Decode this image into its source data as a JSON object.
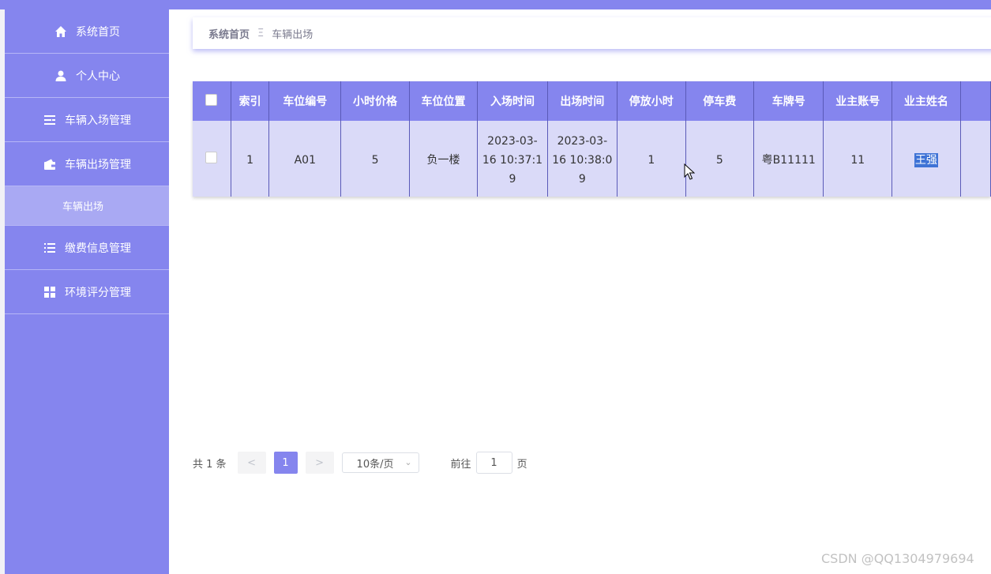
{
  "sidebar": {
    "items": [
      {
        "label": "系统首页",
        "icon": "home-icon"
      },
      {
        "label": "个人中心",
        "icon": "user-icon"
      },
      {
        "label": "车辆入场管理",
        "icon": "list-icon"
      },
      {
        "label": "车辆出场管理",
        "icon": "wallet-icon"
      },
      {
        "label": "车辆出场",
        "icon": ""
      },
      {
        "label": "缴费信息管理",
        "icon": "list-icon"
      },
      {
        "label": "环境评分管理",
        "icon": "grid-icon"
      }
    ]
  },
  "breadcrumb": {
    "home": "系统首页",
    "separator": "Ξ",
    "current": "车辆出场"
  },
  "table": {
    "headers": [
      "索引",
      "车位编号",
      "小时价格",
      "车位位置",
      "入场时间",
      "出场时间",
      "停放小时",
      "停车费",
      "车牌号",
      "业主账号",
      "业主姓名"
    ],
    "rows": [
      {
        "index": "1",
        "spot": "A01",
        "price": "5",
        "location": "负一楼",
        "in_time_1": "2023-03-",
        "in_time_2": "16 10:37:1",
        "in_time_3": "9",
        "out_time_1": "2023-03-",
        "out_time_2": "16 10:38:0",
        "out_time_3": "9",
        "hours": "1",
        "fee": "5",
        "plate": "粤B11111",
        "account": "11",
        "owner": "王强"
      }
    ]
  },
  "pagination": {
    "total": "共 1 条",
    "prev": "<",
    "current": "1",
    "next": ">",
    "page_size": "10条/页",
    "goto": "前往",
    "goto_value": "1",
    "page_suffix": "页"
  },
  "watermark": "CSDN @QQ1304979694",
  "colors": {
    "accent": "#8585ee",
    "row_bg": "#dadaf8",
    "selection": "#3f73d6"
  }
}
